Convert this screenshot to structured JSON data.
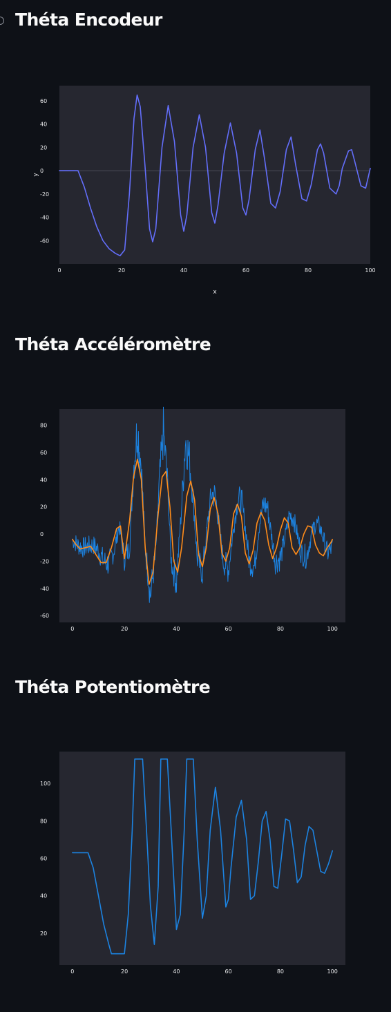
{
  "sections": [
    {
      "title": "Théta Encodeur"
    },
    {
      "title": "Théta Accéléromètre"
    },
    {
      "title": "Théta Potentiomètre"
    }
  ],
  "colors": {
    "background": "#0e1117",
    "plot_background": "#262730",
    "encodeur_line": "#636efa",
    "accel_raw": "#1c83e1",
    "accel_filtered": "#ff8c1a",
    "potentio_line": "#1c83e1"
  },
  "chart_data": [
    {
      "type": "line",
      "title": "",
      "xlabel": "x",
      "ylabel": "y",
      "xlim": [
        0,
        100
      ],
      "ylim": [
        -80,
        73
      ],
      "x_ticks": [
        0,
        20,
        40,
        60,
        80,
        100
      ],
      "y_ticks": [
        -60,
        -40,
        -20,
        0,
        20,
        40,
        60
      ],
      "zero_line": true,
      "series": [
        {
          "color": "#636efa",
          "x": [
            0,
            6,
            8,
            10,
            12,
            14,
            16,
            18,
            19.5,
            21,
            22.5,
            24,
            25,
            26,
            27.5,
            29,
            30,
            31,
            33,
            35,
            37,
            39,
            40,
            41,
            43,
            45,
            47,
            49,
            50,
            51,
            53,
            55,
            57,
            59,
            60,
            61,
            63,
            64.5,
            66,
            68,
            69.5,
            71,
            73,
            74.5,
            76,
            78,
            79.5,
            81,
            83,
            84,
            85,
            87,
            89,
            90,
            91,
            93,
            94,
            95,
            97,
            98.5,
            100
          ],
          "y": [
            0,
            0,
            -14,
            -32,
            -48,
            -60,
            -67,
            -71,
            -73,
            -68,
            -20,
            45,
            65,
            55,
            5,
            -50,
            -61,
            -50,
            20,
            56,
            25,
            -38,
            -52,
            -38,
            20,
            48,
            20,
            -36,
            -45,
            -30,
            15,
            41,
            15,
            -32,
            -38,
            -25,
            18,
            35,
            10,
            -28,
            -32,
            -18,
            18,
            29,
            5,
            -24,
            -26,
            -12,
            18,
            23,
            15,
            -15,
            -20,
            -13,
            2,
            17,
            18,
            8,
            -13,
            -15,
            2
          ]
        }
      ]
    },
    {
      "type": "line",
      "title": "",
      "xlabel": "",
      "ylabel": "",
      "xlim": [
        -5,
        105
      ],
      "ylim": [
        -65,
        92
      ],
      "x_ticks": [
        0,
        20,
        40,
        60,
        80,
        100
      ],
      "y_ticks": [
        -60,
        -40,
        -20,
        0,
        20,
        40,
        60,
        80
      ],
      "series": [
        {
          "color": "#1c83e1",
          "noisy": true,
          "x": [
            0,
            2,
            4,
            6,
            8,
            10,
            12,
            14,
            16,
            18,
            20,
            22,
            23.5,
            25,
            26.5,
            28,
            30,
            32,
            33.5,
            35,
            36.5,
            38,
            40,
            42,
            43.5,
            45,
            46.5,
            48,
            50,
            52,
            53.5,
            55,
            56.5,
            58,
            60,
            62,
            63.5,
            65,
            66.5,
            68,
            70,
            72,
            73.5,
            75,
            76.5,
            78,
            80,
            82,
            83.5,
            85,
            86.5,
            88,
            90,
            92,
            93.5,
            95,
            96.5,
            98,
            100
          ],
          "y": [
            -4,
            -8,
            -10,
            -9,
            -8,
            -12,
            -20,
            -22,
            -12,
            6,
            -18,
            -10,
            48,
            78,
            50,
            -10,
            -45,
            -15,
            40,
            75,
            40,
            -20,
            -35,
            20,
            70,
            55,
            25,
            -18,
            -28,
            8,
            30,
            28,
            5,
            -20,
            -26,
            5,
            25,
            25,
            5,
            -20,
            -24,
            8,
            22,
            20,
            0,
            -20,
            -18,
            0,
            14,
            12,
            0,
            -14,
            -17,
            0,
            8,
            6,
            -3,
            -14,
            -10
          ]
        },
        {
          "color": "#ff8c1a",
          "x": [
            0,
            1.5,
            3,
            5,
            7,
            9,
            11,
            13,
            15,
            17,
            18.5,
            20,
            22,
            23.5,
            25,
            26.5,
            28,
            29.5,
            31,
            33,
            34.5,
            36,
            37.5,
            39,
            40.5,
            42,
            44,
            45.5,
            47,
            48.5,
            50,
            51.5,
            53,
            54.5,
            56,
            57.5,
            59,
            60.5,
            62,
            63.5,
            65,
            66.5,
            68,
            69.5,
            71,
            72.5,
            74,
            75.5,
            77,
            78.5,
            80,
            81.5,
            83,
            84.5,
            86,
            87.5,
            89,
            90.5,
            92,
            93.5,
            95,
            96.5,
            98,
            99.5,
            100
          ],
          "y": [
            -4,
            -8,
            -11,
            -10,
            -9,
            -15,
            -21,
            -21,
            -10,
            4,
            6,
            -18,
            10,
            42,
            55,
            40,
            -10,
            -37,
            -28,
            15,
            42,
            46,
            20,
            -20,
            -28,
            -10,
            28,
            39,
            25,
            -15,
            -24,
            -10,
            18,
            27,
            15,
            -14,
            -20,
            -10,
            15,
            22,
            13,
            -14,
            -22,
            -12,
            8,
            16,
            10,
            -8,
            -18,
            -10,
            3,
            12,
            8,
            -10,
            -15,
            -10,
            0,
            6,
            5,
            -8,
            -14,
            -16,
            -10,
            -6,
            -4
          ]
        }
      ]
    },
    {
      "type": "line",
      "title": "",
      "xlabel": "",
      "ylabel": "",
      "xlim": [
        -5,
        105
      ],
      "ylim": [
        3,
        117
      ],
      "x_ticks": [
        0,
        20,
        40,
        60,
        80,
        100
      ],
      "y_ticks": [
        20,
        40,
        60,
        80,
        100
      ],
      "series": [
        {
          "color": "#1c83e1",
          "x": [
            0,
            6,
            8,
            10,
            12,
            14,
            15,
            20,
            21.5,
            23,
            24,
            27,
            28.5,
            30,
            31.5,
            33,
            34,
            36.5,
            38,
            40,
            41.5,
            43,
            44,
            46.5,
            48,
            50,
            51.5,
            53,
            55,
            57,
            59,
            60,
            61,
            63,
            65,
            67,
            68.5,
            70,
            71.5,
            73,
            74.5,
            76,
            77.5,
            79,
            80.5,
            82,
            83.5,
            85,
            86.5,
            88,
            89.5,
            91,
            92.5,
            94,
            95.5,
            97,
            98.5,
            100
          ],
          "y": [
            63,
            63,
            55,
            40,
            25,
            14,
            9,
            9,
            30,
            75,
            113,
            113,
            75,
            35,
            14,
            45,
            113,
            113,
            75,
            22,
            30,
            75,
            113,
            113,
            70,
            28,
            40,
            75,
            98,
            75,
            34,
            38,
            55,
            82,
            91,
            70,
            38,
            40,
            58,
            80,
            85,
            70,
            45,
            44,
            62,
            81,
            80,
            65,
            47,
            50,
            67,
            77,
            75,
            64,
            53,
            52,
            57,
            64
          ]
        }
      ]
    }
  ]
}
